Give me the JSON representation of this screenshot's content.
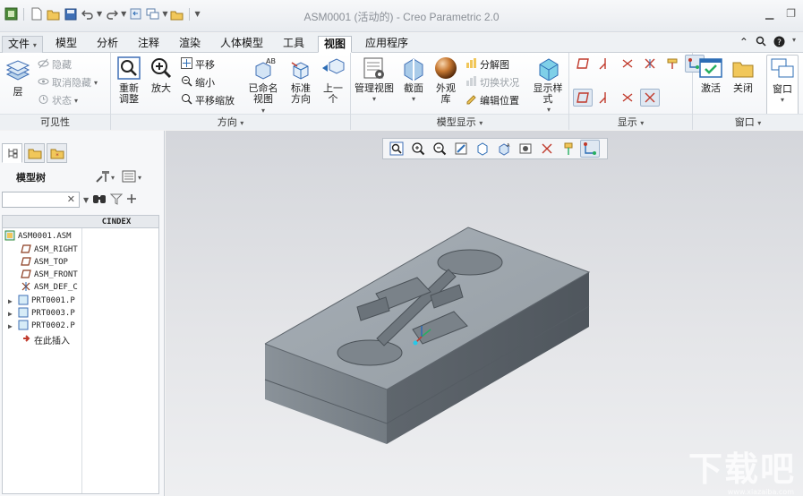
{
  "window": {
    "title": "ASM0001 (活动的) - Creo Parametric 2.0",
    "controls": [
      "minimize-icon",
      "restore-icon"
    ]
  },
  "quick_access": [
    "app-icon",
    "new-icon",
    "open-icon",
    "save-icon",
    "undo-icon",
    "redo-icon",
    "regenerate-icon",
    "windows-icon",
    "close-window-icon",
    "customize-icon"
  ],
  "tabs": [
    {
      "label": "文件"
    },
    {
      "label": "模型"
    },
    {
      "label": "分析"
    },
    {
      "label": "注释"
    },
    {
      "label": "渲染"
    },
    {
      "label": "人体模型"
    },
    {
      "label": "工具"
    },
    {
      "label": "视图"
    },
    {
      "label": "应用程序"
    }
  ],
  "ribbon": {
    "visibility": {
      "label": "可见性",
      "layer": "层",
      "hide": "隐藏",
      "unhide": "取消隐藏",
      "status": "状态"
    },
    "orientation": {
      "label": "方向",
      "refit": "重新调整",
      "zoom_in": "放大",
      "pan": "平移",
      "zoom_out": "缩小",
      "pan_zoom": "平移缩放",
      "named_views": "已命名视图",
      "standard_orientation": "标准方向",
      "previous": "上一个"
    },
    "model_display": {
      "label": "模型显示",
      "manage_views": "管理视图",
      "section": "截面",
      "appearance": "外观库",
      "explode": "分解图",
      "toggle_status": "切换状况",
      "edit_position": "编辑位置",
      "display_style": "显示样式"
    },
    "show": {
      "label": "显示"
    },
    "window": {
      "label": "窗口",
      "activate": "激活",
      "close": "关闭",
      "windows": "窗口"
    }
  },
  "model_tree": {
    "title": "模型树",
    "search_value": "",
    "column_header": "CINDEX",
    "nodes": [
      {
        "label": "ASM0001.ASM",
        "icon": "assembly-icon"
      },
      {
        "label": "ASM_RIGHT",
        "icon": "datum-plane-icon"
      },
      {
        "label": "ASM_TOP",
        "icon": "datum-plane-icon"
      },
      {
        "label": "ASM_FRONT",
        "icon": "datum-plane-icon"
      },
      {
        "label": "ASM_DEF_C",
        "icon": "csys-icon"
      },
      {
        "label": "PRT0001.P",
        "icon": "part-icon"
      },
      {
        "label": "PRT0003.P",
        "icon": "part-icon"
      },
      {
        "label": "PRT0002.P",
        "icon": "part-icon"
      },
      {
        "label": "在此插入",
        "icon": "insert-here-icon"
      }
    ]
  },
  "watermark": {
    "text": "下载吧",
    "url": "www.xiazaiba.com"
  },
  "colors": {
    "accent": "#2d6db5",
    "model_top": "#9ea6ad",
    "model_front": "#7c848b",
    "model_side": "#5d646b"
  }
}
